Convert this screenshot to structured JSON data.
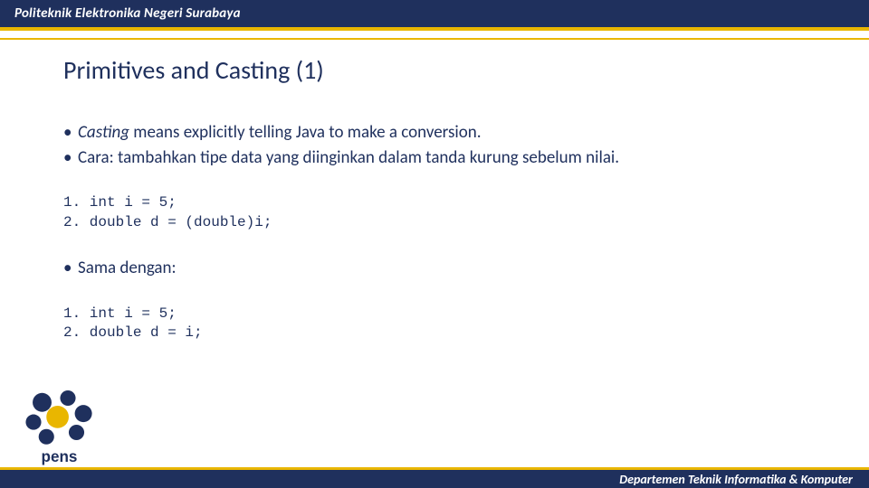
{
  "header": {
    "org": "Politeknik Elektronika Negeri Surabaya"
  },
  "footer": {
    "dept": "Departemen Teknik Informatika & Komputer"
  },
  "title": "Primitives and Casting (1)",
  "bullet1_em": "Casting",
  "bullet1_rest": " means explicitly telling Java to make a conversion.",
  "bullet2": "Cara: tambahkan tipe data yang diinginkan dalam tanda kurung sebelum nilai.",
  "code1_l1": "1. int i = 5;",
  "code1_l2": "2. double d = (double)i;",
  "bullet3": "Sama dengan:",
  "code2_l1": "1. int i = 5;",
  "code2_l2": "2. double d = i;",
  "logo_text": "pens",
  "colors": {
    "navy": "#1f305d",
    "gold": "#e9b600"
  }
}
